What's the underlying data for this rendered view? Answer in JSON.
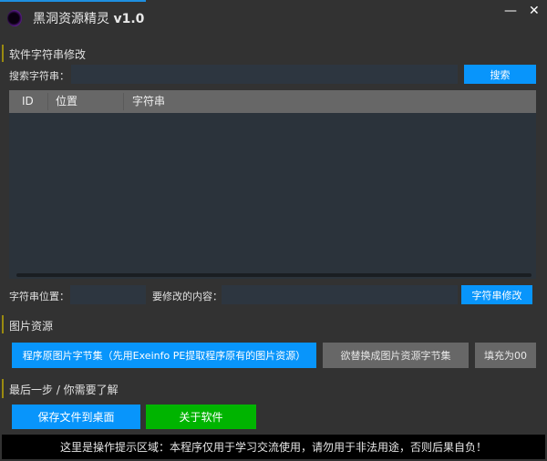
{
  "window": {
    "title": "黑洞资源精灵",
    "version": "v1.0",
    "minimize": "—",
    "close": "✕"
  },
  "strings_section": {
    "heading": "软件字符串修改",
    "search_label": "搜索字符串：",
    "search_value": "",
    "search_button": "搜索",
    "table": {
      "columns": [
        "ID",
        "位置",
        "字符串"
      ],
      "rows": []
    },
    "position_label": "字符串位置：",
    "position_value": "",
    "content_label": "要修改的内容：",
    "content_value": "",
    "modify_button": "字符串修改"
  },
  "image_section": {
    "heading": "图片资源",
    "original_button": "程序原图片字节集（先用Exeinfo PE提取程序原有的图片资源）",
    "replace_button": "欲替换成图片资源字节集",
    "fill_button": "填充为00"
  },
  "final_section": {
    "heading": "最后一步 / 你需要了解",
    "save_button": "保存文件到桌面",
    "about_button": "关于软件"
  },
  "footer": {
    "hint": "这里是操作提示区域：本程序仅用于学习交流使用，请勿用于非法用途，否则后果自负！"
  },
  "colors": {
    "accent_blue": "#0895fb",
    "green": "#00b400",
    "section_marker": "#9a8a10",
    "background": "#323232"
  }
}
